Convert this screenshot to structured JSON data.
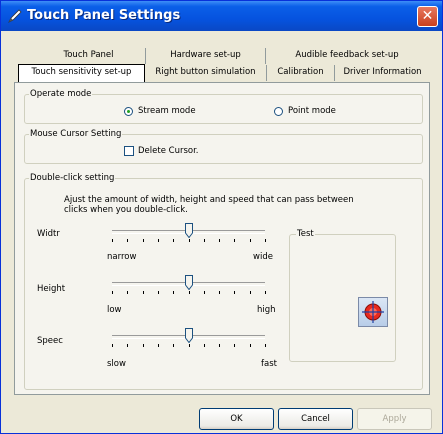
{
  "window": {
    "title": "Touch Panel Settings",
    "close_glyph": "✕"
  },
  "tabs_back": [
    "Touch Panel",
    "Hardware set-up",
    "Audible feedback set-up"
  ],
  "tabs_front": [
    "Touch sensitivity set-up",
    "Right button simulation",
    "Calibration",
    "Driver Information"
  ],
  "operate_mode": {
    "legend": "Operate mode",
    "option1": "Stream mode",
    "option2": "Point mode",
    "selected": "Stream mode"
  },
  "cursor": {
    "legend": "Mouse Cursor Setting",
    "delete_label": "Delete Cursor.",
    "delete_checked": false
  },
  "double_click": {
    "legend": "Double-click setting",
    "description": "Ajust the amount of width, height and speed that can pass between clicks when you double-click.",
    "width": {
      "label": "Widtr",
      "min": "narrow",
      "max": "wide",
      "level": 0.5
    },
    "height": {
      "label": "Height",
      "min": "low",
      "max": "high",
      "level": 0.5
    },
    "speed": {
      "label": "Speec",
      "min": "slow",
      "max": "fast",
      "level": 0.5
    },
    "test": {
      "legend": "Test",
      "icon": "target-icon"
    }
  },
  "buttons": {
    "ok": "OK",
    "cancel": "Cancel",
    "apply": "Apply"
  },
  "colors": {
    "titlebar": "#0653df",
    "window_bg": "#ece9d8",
    "close": "#c9401e"
  }
}
